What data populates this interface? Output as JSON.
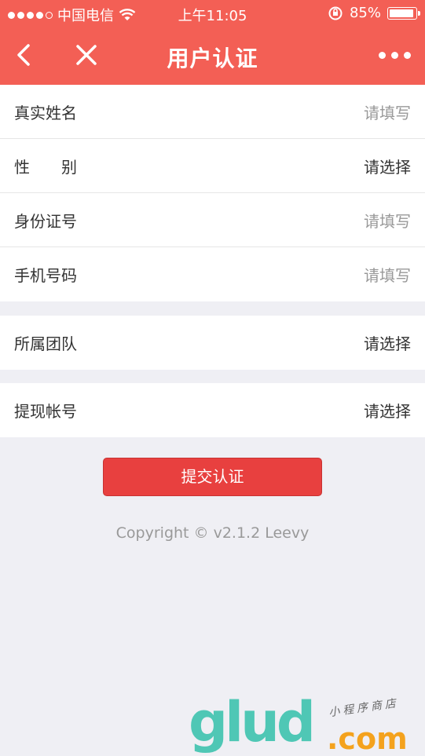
{
  "status_bar": {
    "carrier": "中国电信",
    "time": "上午11:05",
    "battery": "85%",
    "battery_level": 0.85
  },
  "nav": {
    "title": "用户认证"
  },
  "form": {
    "group1": [
      {
        "label": "真实姓名",
        "value": "请填写"
      },
      {
        "label_a": "性",
        "label_b": "别",
        "value": "请选择"
      },
      {
        "label": "身份证号",
        "value": "请填写"
      },
      {
        "label": "手机号码",
        "value": "请填写"
      }
    ],
    "group2": [
      {
        "label": "所属团队",
        "value": "请选择"
      }
    ],
    "group3": [
      {
        "label": "提现帐号",
        "value": "请选择"
      }
    ]
  },
  "submit_label": "提交认证",
  "copyright": "Copyright © v2.1.2 Leevy",
  "watermark": {
    "brand": "glud",
    "domain": ".com",
    "tagline": "小程序商店"
  },
  "colors": {
    "header": "#f35f55",
    "button": "#e8403f",
    "background": "#efeff4"
  }
}
